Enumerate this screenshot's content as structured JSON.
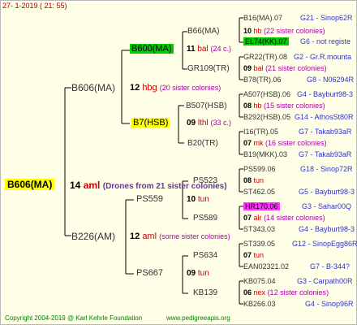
{
  "header": "27-   1-2019  (  21:  55)",
  "footer": {
    "copyright": "Copyright 2004-2019 @ Karl Kehrle Foundation",
    "site": "www.pedigreeapis.org"
  },
  "root": {
    "label": "B606(MA)",
    "num": "14",
    "colony": "aml",
    "note": "(Drones from 21 sister colonies)"
  },
  "father": {
    "label": "B606(MA)",
    "num": "12",
    "colony": "hbg",
    "note": "(20 sister colonies)",
    "sire": {
      "label": "B600(MA)",
      "num": "11",
      "colony": "bal",
      "note": "(24 c.)",
      "sire": {
        "label": "B66(MA)",
        "num": "10",
        "colony": "hb",
        "note": "(22 sister colonies)"
      },
      "dam": {
        "label": "GR109(TR)",
        "num": "09",
        "colony": "bal",
        "note": "(21 sister colonies)"
      }
    },
    "dam": {
      "label": "B7(HSB)",
      "num": "09",
      "colony": "lthl",
      "note": "(33 c.)",
      "sire": {
        "label": "B507(HSB)",
        "num": "08",
        "colony": "hb",
        "note": "(15 sister colonies)"
      },
      "dam": {
        "label": "B20(TR)",
        "num": "07",
        "colony": "mk",
        "note": "(16 sister colonies)"
      }
    }
  },
  "mother": {
    "label": "B226(AM)",
    "num": "12",
    "colony": "aml",
    "note": "(some sister colonies)",
    "sire": {
      "label": "PS559",
      "num": "10",
      "colony": "tun",
      "sire": {
        "label": "PS523",
        "num": "08",
        "colony": "tun"
      },
      "dam": {
        "label": "PS589",
        "num": "07",
        "colony": "alr",
        "note": "(14 sister colonies)"
      }
    },
    "dam": {
      "label": "PS667",
      "num": "09",
      "colony": "tun",
      "sire": {
        "label": "PS634",
        "num": "07",
        "colony": "tun"
      },
      "dam": {
        "label": "KB139",
        "num": "06",
        "colony": "nex",
        "note": "(12 sister colonies)"
      }
    }
  },
  "gen4": [
    {
      "label": "B16(MA).07",
      "ref": "G21 - Sinop62R"
    },
    {
      "label": "EL74(KK).07",
      "ref": "G6 - not registe"
    },
    {
      "label": "GR22(TR).08",
      "ref": "G2 - Gr.R.mounta"
    },
    {
      "label": "B78(TR).06",
      "ref": "G8 - N06294R"
    },
    {
      "label": "A507(HSB).06",
      "ref": "G4 - Bayburt98-3"
    },
    {
      "label": "B292(HSB).05",
      "ref": "G14 - AthosSt80R"
    },
    {
      "label": "I16(TR).05",
      "ref": "G7 - Takab93aR"
    },
    {
      "label": "B19(MKK).03",
      "ref": "G7 - Takab93aR"
    },
    {
      "label": "PS599.06",
      "ref": "G18 - Sinop72R"
    },
    {
      "label": "ST462.05",
      "ref": "G5 - Bayburt98-3"
    },
    {
      "label": "HR170.06",
      "ref": "G3 - Sahar00Q"
    },
    {
      "label": "ST343.03",
      "ref": "G4 - Bayburt98-3"
    },
    {
      "label": "ST339.05",
      "ref": "G12 - SinopEgg86R"
    },
    {
      "label": "EAN02321.02",
      "ref": "G7 - B-344?"
    },
    {
      "label": "KB075.04",
      "ref": "G3 - Carpath00R"
    },
    {
      "label": "KB266.03",
      "ref": "G4 - Sinop96R"
    }
  ]
}
